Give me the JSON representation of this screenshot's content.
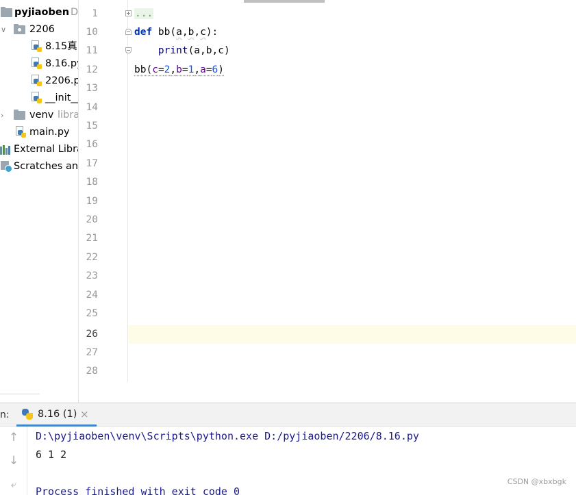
{
  "project_tree": {
    "root": {
      "name": "pyjiaoben",
      "path_hint": "D"
    },
    "items": [
      {
        "label": "2206",
        "kind": "folder",
        "expanded": true
      },
      {
        "label": "8.15真",
        "kind": "pyfile"
      },
      {
        "label": "8.16.py",
        "kind": "pyfile"
      },
      {
        "label": "2206.p",
        "kind": "pyfile"
      },
      {
        "label": "__init__",
        "kind": "pyfile"
      },
      {
        "label": "venv",
        "hint": "libra",
        "kind": "folder",
        "expanded": false
      },
      {
        "label": "main.py",
        "kind": "pyfile"
      },
      {
        "label": "External Libra",
        "kind": "libraries"
      },
      {
        "label": "Scratches and",
        "kind": "scratches"
      }
    ]
  },
  "editor": {
    "current_line": 26,
    "line_numbers": [
      "1",
      "10",
      "11",
      "12",
      "13",
      "14",
      "15",
      "16",
      "17",
      "18",
      "19",
      "20",
      "21",
      "22",
      "23",
      "24",
      "25",
      "26",
      "27",
      "28"
    ],
    "code": {
      "line1_collapsed": "...",
      "line10": {
        "kw": "def",
        "rest_a": " bb(",
        "p_a": "a",
        "sep1": ",",
        "p_b": "b",
        "sep2": ",",
        "p_c": "c",
        "rest_b": "):"
      },
      "line11": {
        "indent": "    ",
        "builtin": "print",
        "args": "(a,b,c)"
      },
      "line12": {
        "call": "bb(",
        "k1": "c",
        "eq1": "=",
        "v1": "2",
        "s1": ",",
        "k2": "b",
        "eq2": "=",
        "v2": "1",
        "s2": ",",
        "k3": "a",
        "eq3": "=",
        "v3": "6",
        "close": ")"
      }
    }
  },
  "run_panel": {
    "label": "n:",
    "tab": {
      "title": "8.16 (1)",
      "close": "×"
    },
    "output": {
      "command": "D:\\pyjiaoben\\venv\\Scripts\\python.exe D:/pyjiaoben/2206/8.16.py",
      "result": "6 1 2",
      "exit": "Process finished with exit code 0"
    },
    "side_icons": [
      "arrow-up-icon",
      "arrow-down-icon",
      "soft-wrap-icon"
    ]
  },
  "watermark": "CSDN @xbxbgk"
}
